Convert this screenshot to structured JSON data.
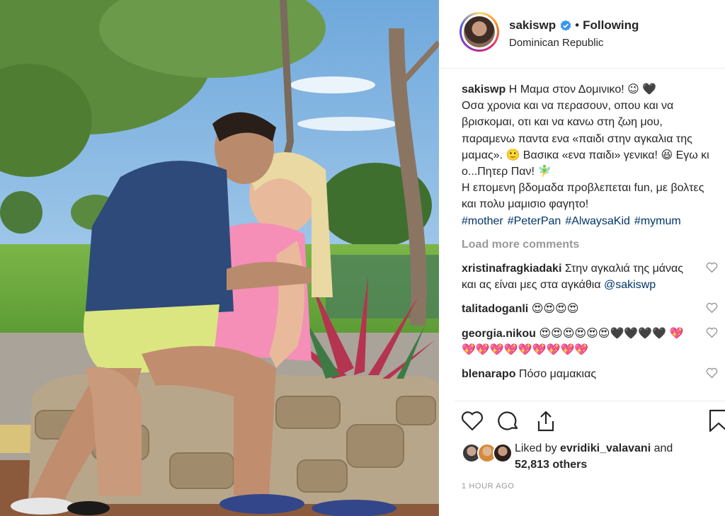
{
  "post": {
    "username": "sakiswp",
    "follow_status": "Following",
    "separator": "•",
    "location": "Dominican Republic",
    "caption": {
      "username": "sakiswp",
      "lines": [
        "Η Μαμα στον Δομινικο! 😉 🖤",
        "Οσα χρονια και να περασουν, οπου και να βρισκομαι, οτι και να κανω στη ζωη μου, παραμενω παντα ενα «παιδι στην αγκαλια της μαμας». 🙂 Βασικα «ενα παιδι» γενικα! 😆 Εγω κι ο...Πητερ Παν! 🧚‍♂️",
        "Η επομενη βδομαδα προβλεπεται fun, με βολτες και πολυ μαμισιο φαγητο!"
      ],
      "hashtags": [
        "#mother",
        "#PeterPan",
        "#AlwaysaKid",
        "#mymum"
      ]
    },
    "load_more": "Load more comments",
    "comments": [
      {
        "user": "xristinafragkiadaki",
        "text": "Στην αγκαλιά της μάνας και ας είναι μες στα αγκάθια",
        "mention": "@sakiswp"
      },
      {
        "user": "talitadoganli",
        "text": "😍😍😍😍",
        "mention": ""
      },
      {
        "user": "georgia.nikou",
        "text": "😍😍😍😍😍😍🖤🖤🖤🖤 💖💖💖💖💖💖💖💖💖💖",
        "mention": ""
      },
      {
        "user": "blenarapo",
        "text": "Πόσο μαμακιας",
        "mention": ""
      }
    ],
    "likes": {
      "prefix": "Liked by",
      "user": "evridiki_valavani",
      "and": "and",
      "count": "52,813 others"
    },
    "timestamp": "1 HOUR AGO"
  },
  "icons": {
    "verified": "verified-badge-icon",
    "like": "heart-icon",
    "comment": "comment-bubble-icon",
    "share": "share-icon",
    "save": "bookmark-icon"
  },
  "colors": {
    "accent_blue": "#3897f0",
    "link": "#003569",
    "muted": "#999999"
  }
}
